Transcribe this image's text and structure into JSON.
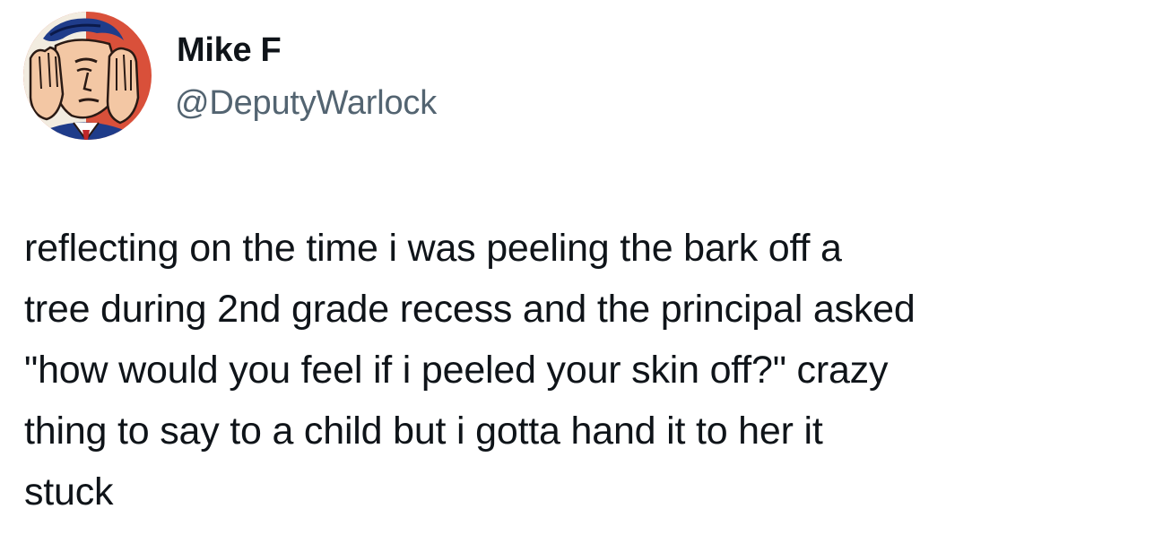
{
  "author": {
    "display_name": "Mike F",
    "handle": "@DeputyWarlock",
    "avatar_icon": "comic-facepalm-avatar"
  },
  "tweet": {
    "lines": [
      "reflecting on the time i was peeling the bark off a",
      "tree during 2nd grade recess and the principal asked",
      "\"how would you feel if i peeled your skin off?\" crazy",
      "thing to say to a child but i gotta hand it to her it",
      "stuck"
    ]
  },
  "colors": {
    "text": "#0f1419",
    "handle": "#536471",
    "avatar_background": "#d9503a"
  }
}
